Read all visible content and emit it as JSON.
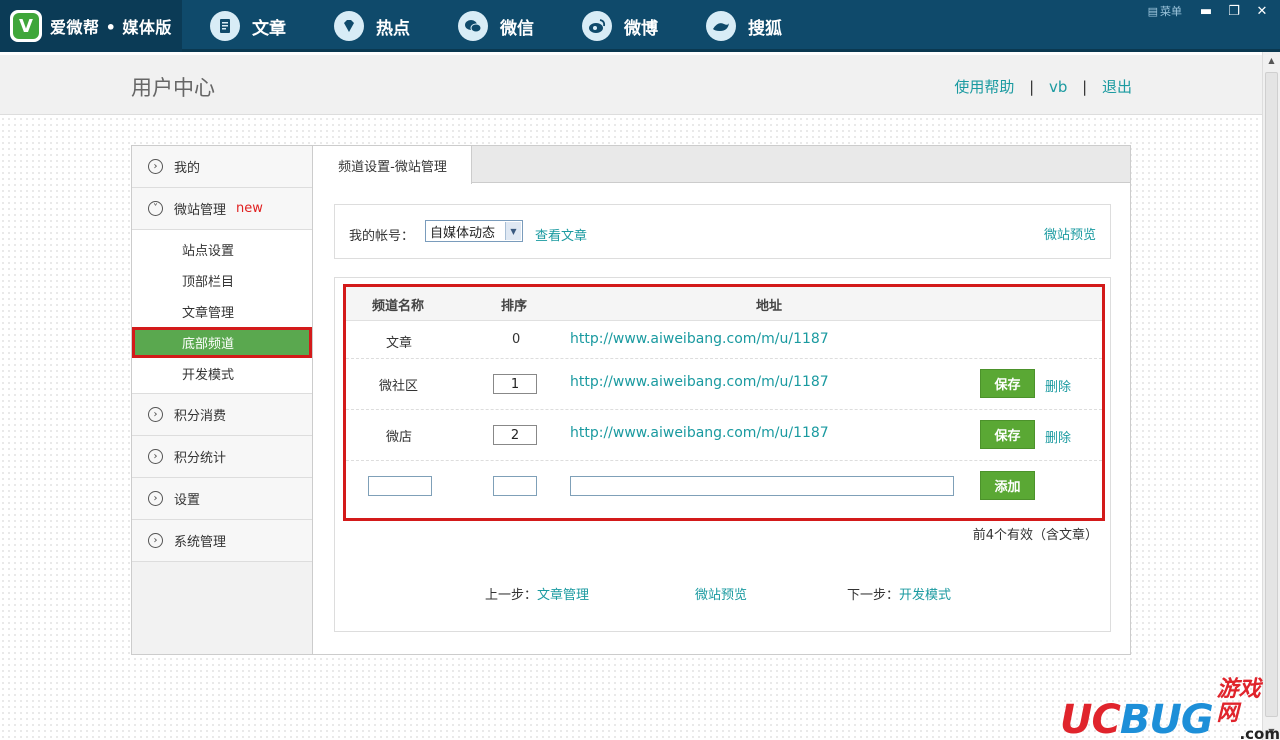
{
  "app": {
    "logo_glyph": "V",
    "logo_text": "爱微帮 • 媒体版"
  },
  "nav": [
    {
      "label": "文章",
      "icon": "document-icon"
    },
    {
      "label": "热点",
      "icon": "diamond-icon"
    },
    {
      "label": "微信",
      "icon": "wechat-icon"
    },
    {
      "label": "微博",
      "icon": "weibo-icon"
    },
    {
      "label": "搜狐",
      "icon": "sohu-icon"
    }
  ],
  "window": {
    "menu_label": "菜单"
  },
  "header": {
    "title": "用户中心",
    "help": "使用帮助",
    "user": "vb",
    "logout": "退出"
  },
  "sidebar": {
    "mine": "我的",
    "site_manage": "微站管理",
    "new_badge": "new",
    "sub_items": [
      "站点设置",
      "顶部栏目",
      "文章管理",
      "底部频道",
      "开发模式"
    ],
    "active_sub": "底部频道",
    "points_consume": "积分消费",
    "points_stats": "积分统计",
    "settings": "设置",
    "system": "系统管理"
  },
  "tab": {
    "label": "频道设置-微站管理"
  },
  "account": {
    "label": "我的帐号：",
    "selected": "自媒体动态",
    "view_articles": "查看文章",
    "site_preview": "微站预览"
  },
  "table": {
    "headers": {
      "name": "频道名称",
      "order": "排序",
      "address": "地址"
    },
    "rows": [
      {
        "name": "文章",
        "order": "0",
        "url": "http://www.aiweibang.com/m/u/1187"
      },
      {
        "name": "微社区",
        "order": "1",
        "url": "http://www.aiweibang.com/m/u/1187",
        "save": "保存",
        "delete": "删除"
      },
      {
        "name": "微店",
        "order": "2",
        "url": "http://www.aiweibang.com/m/u/1187",
        "save": "保存",
        "delete": "删除"
      }
    ],
    "add_label": "添加",
    "note": "前4个有效（含文章）"
  },
  "steps": {
    "prev_label": "上一步：",
    "prev_link": "文章管理",
    "preview": "微站预览",
    "next_label": "下一步：",
    "next_link": "开发模式"
  },
  "watermark": {
    "brand": "UCBUG",
    "cn": "游戏网",
    "domain": ".com"
  },
  "colors": {
    "accent": "#1a9aa0",
    "topbar": "#0f4a6b",
    "button_green": "#5aa834",
    "highlight_red": "#d31a1a"
  }
}
